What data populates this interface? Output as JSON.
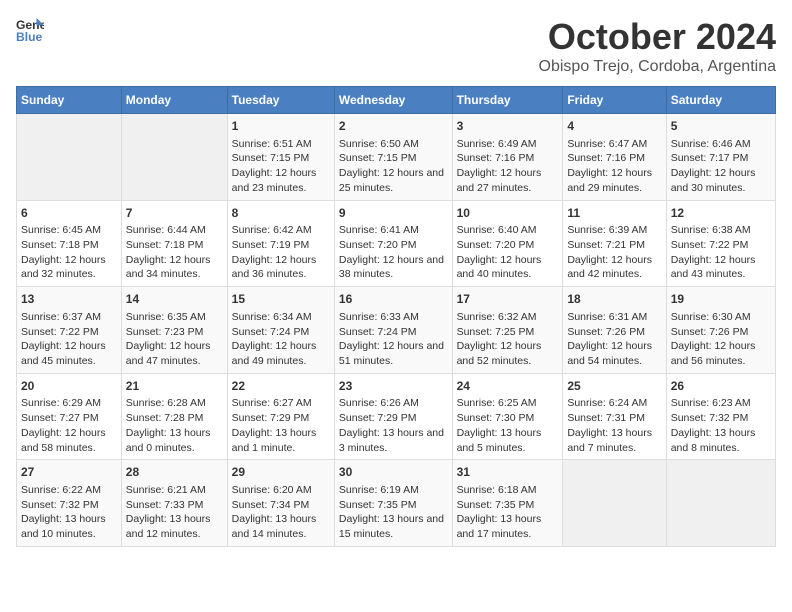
{
  "header": {
    "logo_line1": "General",
    "logo_line2": "Blue",
    "main_title": "October 2024",
    "subtitle": "Obispo Trejo, Cordoba, Argentina"
  },
  "columns": [
    "Sunday",
    "Monday",
    "Tuesday",
    "Wednesday",
    "Thursday",
    "Friday",
    "Saturday"
  ],
  "weeks": [
    [
      {
        "day": "",
        "sunrise": "",
        "sunset": "",
        "daylight": ""
      },
      {
        "day": "",
        "sunrise": "",
        "sunset": "",
        "daylight": ""
      },
      {
        "day": "1",
        "sunrise": "Sunrise: 6:51 AM",
        "sunset": "Sunset: 7:15 PM",
        "daylight": "Daylight: 12 hours and 23 minutes."
      },
      {
        "day": "2",
        "sunrise": "Sunrise: 6:50 AM",
        "sunset": "Sunset: 7:15 PM",
        "daylight": "Daylight: 12 hours and 25 minutes."
      },
      {
        "day": "3",
        "sunrise": "Sunrise: 6:49 AM",
        "sunset": "Sunset: 7:16 PM",
        "daylight": "Daylight: 12 hours and 27 minutes."
      },
      {
        "day": "4",
        "sunrise": "Sunrise: 6:47 AM",
        "sunset": "Sunset: 7:16 PM",
        "daylight": "Daylight: 12 hours and 29 minutes."
      },
      {
        "day": "5",
        "sunrise": "Sunrise: 6:46 AM",
        "sunset": "Sunset: 7:17 PM",
        "daylight": "Daylight: 12 hours and 30 minutes."
      }
    ],
    [
      {
        "day": "6",
        "sunrise": "Sunrise: 6:45 AM",
        "sunset": "Sunset: 7:18 PM",
        "daylight": "Daylight: 12 hours and 32 minutes."
      },
      {
        "day": "7",
        "sunrise": "Sunrise: 6:44 AM",
        "sunset": "Sunset: 7:18 PM",
        "daylight": "Daylight: 12 hours and 34 minutes."
      },
      {
        "day": "8",
        "sunrise": "Sunrise: 6:42 AM",
        "sunset": "Sunset: 7:19 PM",
        "daylight": "Daylight: 12 hours and 36 minutes."
      },
      {
        "day": "9",
        "sunrise": "Sunrise: 6:41 AM",
        "sunset": "Sunset: 7:20 PM",
        "daylight": "Daylight: 12 hours and 38 minutes."
      },
      {
        "day": "10",
        "sunrise": "Sunrise: 6:40 AM",
        "sunset": "Sunset: 7:20 PM",
        "daylight": "Daylight: 12 hours and 40 minutes."
      },
      {
        "day": "11",
        "sunrise": "Sunrise: 6:39 AM",
        "sunset": "Sunset: 7:21 PM",
        "daylight": "Daylight: 12 hours and 42 minutes."
      },
      {
        "day": "12",
        "sunrise": "Sunrise: 6:38 AM",
        "sunset": "Sunset: 7:22 PM",
        "daylight": "Daylight: 12 hours and 43 minutes."
      }
    ],
    [
      {
        "day": "13",
        "sunrise": "Sunrise: 6:37 AM",
        "sunset": "Sunset: 7:22 PM",
        "daylight": "Daylight: 12 hours and 45 minutes."
      },
      {
        "day": "14",
        "sunrise": "Sunrise: 6:35 AM",
        "sunset": "Sunset: 7:23 PM",
        "daylight": "Daylight: 12 hours and 47 minutes."
      },
      {
        "day": "15",
        "sunrise": "Sunrise: 6:34 AM",
        "sunset": "Sunset: 7:24 PM",
        "daylight": "Daylight: 12 hours and 49 minutes."
      },
      {
        "day": "16",
        "sunrise": "Sunrise: 6:33 AM",
        "sunset": "Sunset: 7:24 PM",
        "daylight": "Daylight: 12 hours and 51 minutes."
      },
      {
        "day": "17",
        "sunrise": "Sunrise: 6:32 AM",
        "sunset": "Sunset: 7:25 PM",
        "daylight": "Daylight: 12 hours and 52 minutes."
      },
      {
        "day": "18",
        "sunrise": "Sunrise: 6:31 AM",
        "sunset": "Sunset: 7:26 PM",
        "daylight": "Daylight: 12 hours and 54 minutes."
      },
      {
        "day": "19",
        "sunrise": "Sunrise: 6:30 AM",
        "sunset": "Sunset: 7:26 PM",
        "daylight": "Daylight: 12 hours and 56 minutes."
      }
    ],
    [
      {
        "day": "20",
        "sunrise": "Sunrise: 6:29 AM",
        "sunset": "Sunset: 7:27 PM",
        "daylight": "Daylight: 12 hours and 58 minutes."
      },
      {
        "day": "21",
        "sunrise": "Sunrise: 6:28 AM",
        "sunset": "Sunset: 7:28 PM",
        "daylight": "Daylight: 13 hours and 0 minutes."
      },
      {
        "day": "22",
        "sunrise": "Sunrise: 6:27 AM",
        "sunset": "Sunset: 7:29 PM",
        "daylight": "Daylight: 13 hours and 1 minute."
      },
      {
        "day": "23",
        "sunrise": "Sunrise: 6:26 AM",
        "sunset": "Sunset: 7:29 PM",
        "daylight": "Daylight: 13 hours and 3 minutes."
      },
      {
        "day": "24",
        "sunrise": "Sunrise: 6:25 AM",
        "sunset": "Sunset: 7:30 PM",
        "daylight": "Daylight: 13 hours and 5 minutes."
      },
      {
        "day": "25",
        "sunrise": "Sunrise: 6:24 AM",
        "sunset": "Sunset: 7:31 PM",
        "daylight": "Daylight: 13 hours and 7 minutes."
      },
      {
        "day": "26",
        "sunrise": "Sunrise: 6:23 AM",
        "sunset": "Sunset: 7:32 PM",
        "daylight": "Daylight: 13 hours and 8 minutes."
      }
    ],
    [
      {
        "day": "27",
        "sunrise": "Sunrise: 6:22 AM",
        "sunset": "Sunset: 7:32 PM",
        "daylight": "Daylight: 13 hours and 10 minutes."
      },
      {
        "day": "28",
        "sunrise": "Sunrise: 6:21 AM",
        "sunset": "Sunset: 7:33 PM",
        "daylight": "Daylight: 13 hours and 12 minutes."
      },
      {
        "day": "29",
        "sunrise": "Sunrise: 6:20 AM",
        "sunset": "Sunset: 7:34 PM",
        "daylight": "Daylight: 13 hours and 14 minutes."
      },
      {
        "day": "30",
        "sunrise": "Sunrise: 6:19 AM",
        "sunset": "Sunset: 7:35 PM",
        "daylight": "Daylight: 13 hours and 15 minutes."
      },
      {
        "day": "31",
        "sunrise": "Sunrise: 6:18 AM",
        "sunset": "Sunset: 7:35 PM",
        "daylight": "Daylight: 13 hours and 17 minutes."
      },
      {
        "day": "",
        "sunrise": "",
        "sunset": "",
        "daylight": ""
      },
      {
        "day": "",
        "sunrise": "",
        "sunset": "",
        "daylight": ""
      }
    ]
  ]
}
